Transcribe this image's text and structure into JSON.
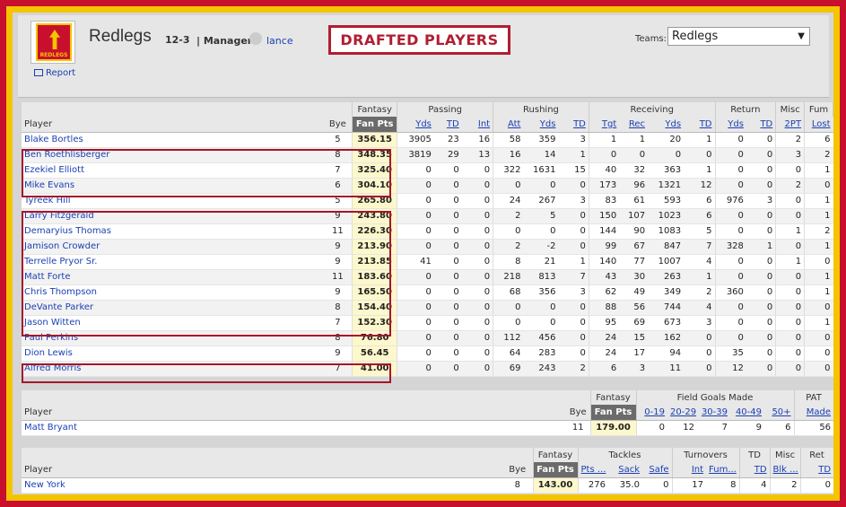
{
  "team": {
    "name": "Redlegs",
    "record": "12-3",
    "manager_label": "| Manager:",
    "manager": "lance",
    "logo_text": "REDLEGS",
    "report": "Report"
  },
  "banner": "DRAFTED PLAYERS",
  "selector": {
    "label": "Teams:",
    "value": "Redlegs"
  },
  "colors": {
    "outer": "#c8102e",
    "inner": "#f5c400",
    "highlight": "#a5162b",
    "link": "#1a3fb4"
  },
  "offense": {
    "groups": [
      "Fantasy",
      "Passing",
      "Rushing",
      "Receiving",
      "Return",
      "Misc",
      "Fum"
    ],
    "cols": [
      "Player",
      "Bye",
      "Fan Pts",
      "Yds",
      "TD",
      "Int",
      "Att",
      "Yds",
      "TD",
      "Tgt",
      "Rec",
      "Yds",
      "TD",
      "Yds",
      "TD",
      "2PT",
      "Lost"
    ],
    "rows": [
      [
        "Blake Bortles",
        "5",
        "356.15",
        "3905",
        "23",
        "16",
        "58",
        "359",
        "3",
        "1",
        "1",
        "20",
        "1",
        "0",
        "0",
        "2",
        "6"
      ],
      [
        "Ben Roethlisberger",
        "8",
        "348.35",
        "3819",
        "29",
        "13",
        "16",
        "14",
        "1",
        "0",
        "0",
        "0",
        "0",
        "0",
        "0",
        "3",
        "2"
      ],
      [
        "Ezekiel Elliott",
        "7",
        "325.40",
        "0",
        "0",
        "0",
        "322",
        "1631",
        "15",
        "40",
        "32",
        "363",
        "1",
        "0",
        "0",
        "0",
        "1"
      ],
      [
        "Mike Evans",
        "6",
        "304.10",
        "0",
        "0",
        "0",
        "0",
        "0",
        "0",
        "173",
        "96",
        "1321",
        "12",
        "0",
        "0",
        "2",
        "0"
      ],
      [
        "Tyreek Hill",
        "5",
        "265.80",
        "0",
        "0",
        "0",
        "24",
        "267",
        "3",
        "83",
        "61",
        "593",
        "6",
        "976",
        "3",
        "0",
        "1"
      ],
      [
        "Larry Fitzgerald",
        "9",
        "243.80",
        "0",
        "0",
        "0",
        "2",
        "5",
        "0",
        "150",
        "107",
        "1023",
        "6",
        "0",
        "0",
        "0",
        "1"
      ],
      [
        "Demaryius Thomas",
        "11",
        "226.30",
        "0",
        "0",
        "0",
        "0",
        "0",
        "0",
        "144",
        "90",
        "1083",
        "5",
        "0",
        "0",
        "1",
        "2"
      ],
      [
        "Jamison Crowder",
        "9",
        "213.90",
        "0",
        "0",
        "0",
        "2",
        "-2",
        "0",
        "99",
        "67",
        "847",
        "7",
        "328",
        "1",
        "0",
        "1"
      ],
      [
        "Terrelle Pryor Sr.",
        "9",
        "213.85",
        "41",
        "0",
        "0",
        "8",
        "21",
        "1",
        "140",
        "77",
        "1007",
        "4",
        "0",
        "0",
        "1",
        "0"
      ],
      [
        "Matt Forte",
        "11",
        "183.60",
        "0",
        "0",
        "0",
        "218",
        "813",
        "7",
        "43",
        "30",
        "263",
        "1",
        "0",
        "0",
        "0",
        "1"
      ],
      [
        "Chris Thompson",
        "9",
        "165.50",
        "0",
        "0",
        "0",
        "68",
        "356",
        "3",
        "62",
        "49",
        "349",
        "2",
        "360",
        "0",
        "0",
        "1"
      ],
      [
        "DeVante Parker",
        "8",
        "154.40",
        "0",
        "0",
        "0",
        "0",
        "0",
        "0",
        "88",
        "56",
        "744",
        "4",
        "0",
        "0",
        "0",
        "0"
      ],
      [
        "Jason Witten",
        "7",
        "152.30",
        "0",
        "0",
        "0",
        "0",
        "0",
        "0",
        "95",
        "69",
        "673",
        "3",
        "0",
        "0",
        "0",
        "1"
      ],
      [
        "Paul Perkins",
        "8",
        "76.80",
        "0",
        "0",
        "0",
        "112",
        "456",
        "0",
        "24",
        "15",
        "162",
        "0",
        "0",
        "0",
        "0",
        "0"
      ],
      [
        "Dion Lewis",
        "9",
        "56.45",
        "0",
        "0",
        "0",
        "64",
        "283",
        "0",
        "24",
        "17",
        "94",
        "0",
        "35",
        "0",
        "0",
        "0"
      ],
      [
        "Alfred Morris",
        "7",
        "41.00",
        "0",
        "0",
        "0",
        "69",
        "243",
        "2",
        "6",
        "3",
        "11",
        "0",
        "12",
        "0",
        "0",
        "0"
      ]
    ]
  },
  "kicker": {
    "groups": [
      "Fantasy",
      "Field Goals Made",
      "PAT"
    ],
    "cols": [
      "Player",
      "Bye",
      "Fan Pts",
      "0-19",
      "20-29",
      "30-39",
      "40-49",
      "50+",
      "Made"
    ],
    "rows": [
      [
        "Matt Bryant",
        "11",
        "179.00",
        "0",
        "12",
        "7",
        "9",
        "6",
        "56"
      ]
    ]
  },
  "defense": {
    "groups": [
      "Fantasy",
      "Tackles",
      "Turnovers",
      "TD",
      "Misc",
      "Ret"
    ],
    "cols": [
      "Player",
      "Bye",
      "Fan Pts",
      "Pts ...",
      "Sack",
      "Safe",
      "Int",
      "Fum...",
      "TD",
      "Blk ...",
      "TD"
    ],
    "rows": [
      [
        "New York",
        "8",
        "143.00",
        "276",
        "35.0",
        "0",
        "17",
        "8",
        "4",
        "2",
        "0"
      ]
    ]
  }
}
